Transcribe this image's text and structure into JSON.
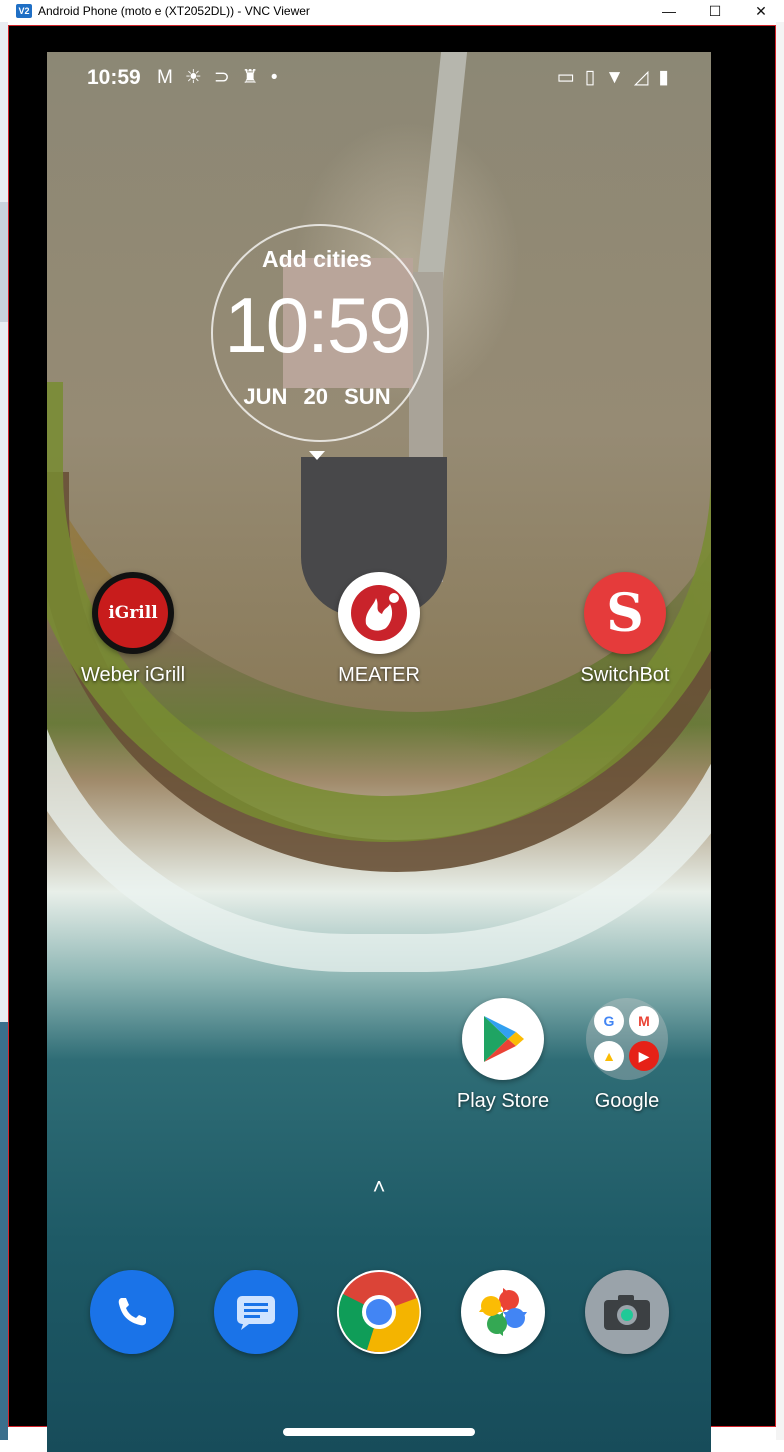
{
  "window": {
    "title": "Android Phone (moto e (XT2052DL)) - VNC Viewer",
    "app_icon_text": "V2",
    "minimize": "—",
    "maximize": "☐",
    "close": "✕"
  },
  "statusbar": {
    "time": "10:59",
    "left_icons": [
      "gmail-icon",
      "brightness-icon",
      "return-icon",
      "lighthouse-icon",
      "dot-icon"
    ],
    "right_icons": [
      "cast-icon",
      "vibrate-icon",
      "wifi-icon",
      "signal-icon",
      "battery-icon"
    ]
  },
  "clock_widget": {
    "cities": "Add cities",
    "time": "10:59",
    "date": "JUN 20 SUN"
  },
  "apps": {
    "weber": {
      "label": "Weber iGrill",
      "icon_text": "iGrill"
    },
    "meater": {
      "label": "MEATER"
    },
    "switchbot": {
      "label": "SwitchBot",
      "icon_text": "S"
    },
    "playstore": {
      "label": "Play Store"
    },
    "google": {
      "label": "Google",
      "mini": [
        "G",
        "M",
        "▲",
        "▶"
      ]
    }
  },
  "drawer_arrow": "˄",
  "dock": [
    "phone-icon",
    "messages-icon",
    "chrome-icon",
    "photos-icon",
    "camera-icon"
  ]
}
